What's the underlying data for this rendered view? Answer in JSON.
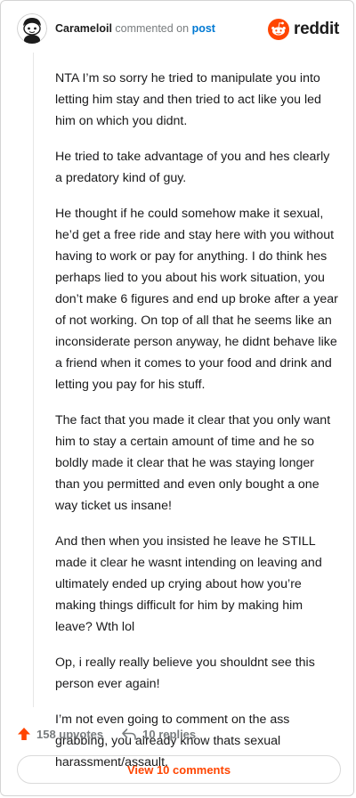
{
  "header": {
    "username": "Carameloil",
    "action_text": "commented on",
    "post_link": "post",
    "brand": "reddit"
  },
  "comment": {
    "paragraphs": [
      "NTA I’m so sorry he tried to manipulate you into letting him stay and then tried to act like you led him on which you didnt.",
      "He tried to take advantage of you and hes clearly a predatory kind of guy.",
      "He thought if he could somehow make it sexual, he’d get a free ride and stay here with you without having to work or pay for anything. I do think hes perhaps lied to you about his work situation, you don’t make 6 figures and end up broke after a year of not working. On top of all that he seems like an inconsiderate person anyway, he didnt behave like a friend when it comes to your food and drink and letting you pay for his stuff.",
      "The fact that you made it clear that you only want him to stay a certain amount of time and he so boldly made it clear that he was staying longer than you permitted and even only bought a one way ticket us insane!",
      "And then when you insisted he leave he STILL made it clear he wasnt intending on leaving and ultimately ended up crying about how you’re making things difficult for him by making him leave? Wth lol",
      "Op, i really really believe you shouldnt see this person ever again!",
      "I’m not even going to comment on the ass grabbing, you already know thats sexual harassment/assault."
    ]
  },
  "footer": {
    "upvotes": "158 upvotes",
    "replies": "10 replies",
    "view_comments": "View 10 comments"
  },
  "icons": {
    "avatar": "snoo-avatar-icon",
    "brand": "reddit-logo-icon",
    "upvote": "upvote-arrow-icon",
    "reply": "reply-arrow-icon"
  },
  "colors": {
    "accent": "#ff4500",
    "link": "#0079d3",
    "muted": "#787c7e"
  }
}
